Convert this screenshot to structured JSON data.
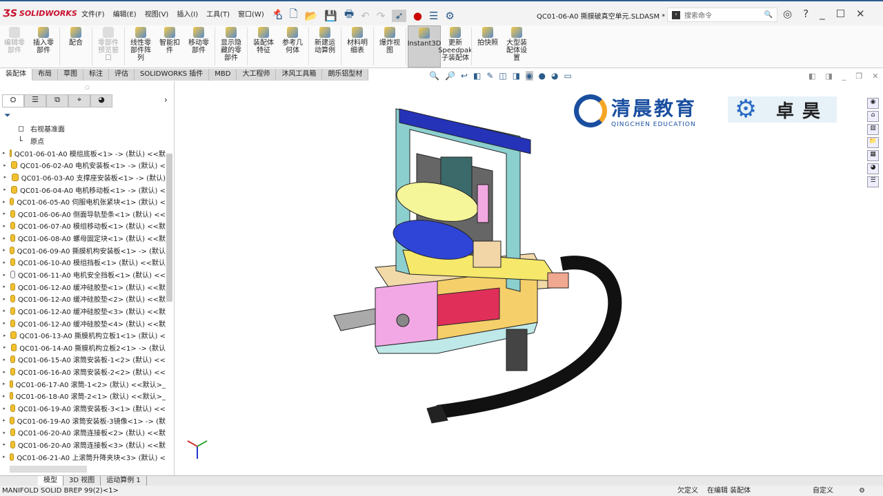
{
  "app": {
    "logo": "SOLIDWORKS",
    "title": "QC01-06-A0 撕膜破真空单元.SLDASM *",
    "search_placeholder": "搜索命令"
  },
  "menu": [
    "文件(F)",
    "编辑(E)",
    "视图(V)",
    "插入(I)",
    "工具(T)",
    "窗口(W)"
  ],
  "ribbon": [
    {
      "label": "编辑零部件",
      "disabled": true
    },
    {
      "label": "插入零部件"
    },
    {
      "label": "配合"
    },
    {
      "label": "零部件预览窗口",
      "disabled": true
    },
    {
      "label": "线性零部件阵列"
    },
    {
      "label": "智能扣件"
    },
    {
      "label": "移动零部件"
    },
    {
      "label": "显示隐藏的零部件"
    },
    {
      "label": "装配体特征"
    },
    {
      "label": "参考几何体"
    },
    {
      "label": "新建运动算例"
    },
    {
      "label": "材料明细表"
    },
    {
      "label": "爆炸视图"
    },
    {
      "label": "Instant3D",
      "selected": true
    },
    {
      "label": "更新Speedpak子装配体"
    },
    {
      "label": "拍快照"
    },
    {
      "label": "大型装配体设置"
    }
  ],
  "tabs": [
    "装配体",
    "布局",
    "草图",
    "标注",
    "评估",
    "SOLIDWORKS 插件",
    "MBD",
    "大工程师",
    "沐风工具箱",
    "朗乐铝型材"
  ],
  "tree": [
    {
      "label": "右视基准面",
      "type": "plane"
    },
    {
      "label": "原点",
      "type": "origin"
    },
    {
      "label": "QC01-06-01-A0 模组底板<1> -> (默认) <<默"
    },
    {
      "label": "QC01-06-02-A0 电机安装板<1> -> (默认) <"
    },
    {
      "label": "QC01-06-03-A0 支撑座安装板<1> -> (默认)"
    },
    {
      "label": "QC01-06-04-A0 电机移动板<1> -> (默认) <"
    },
    {
      "label": "QC01-06-05-A0 伺服电机张紧块<1> (默认) <"
    },
    {
      "label": "QC01-06-06-A0 侧面导轨垫条<1> (默认) <<"
    },
    {
      "label": "QC01-06-07-A0 模组移动板<1> (默认) <<默"
    },
    {
      "label": "QC01-06-08-A0 螺母固定块<1> (默认) <<默"
    },
    {
      "label": "QC01-06-09-A0 撕膜机构安装板<1> -> (默认"
    },
    {
      "label": "QC01-06-10-A0 模组挡板<1> (默认) <<默认"
    },
    {
      "label": "QC01-06-11-A0 电机安全挡板<1> (默认) <<",
      "light": true
    },
    {
      "label": "QC01-06-12-A0 缓冲硅胶垫<1> (默认) <<默"
    },
    {
      "label": "QC01-06-12-A0 缓冲硅胶垫<2> (默认) <<默"
    },
    {
      "label": "QC01-06-12-A0 缓冲硅胶垫<3> (默认) <<默"
    },
    {
      "label": "QC01-06-12-A0 缓冲硅胶垫<4> (默认) <<默"
    },
    {
      "label": "QC01-06-13-A0 撕膜机构立板1<1> (默认) <"
    },
    {
      "label": "QC01-06-14-A0 撕膜机构立板2<1> -> (默认"
    },
    {
      "label": "QC01-06-15-A0 滚筒安装板-1<2> (默认) <<"
    },
    {
      "label": "QC01-06-16-A0 滚筒安装板-2<2> (默认) <<"
    },
    {
      "label": "QC01-06-17-A0 滚筒-1<2> (默认) <<默认>_"
    },
    {
      "label": "QC01-06-18-A0 滚筒-2<1> (默认) <<默认>_"
    },
    {
      "label": "QC01-06-19-A0 滚筒安装板-3<1> (默认) <<"
    },
    {
      "label": "QC01-06-19-A0 滚筒安装板-3镜像<1> -> (默"
    },
    {
      "label": "QC01-06-20-A0 滚筒连接板<2> (默认) <<默"
    },
    {
      "label": "QC01-06-20-A0 滚筒连接板<3> (默认) <<默"
    },
    {
      "label": "QC01-06-21-A0 上滚筒升降夹块<3> (默认) <"
    }
  ],
  "bottom_tabs": [
    "模型",
    "3D 视图",
    "运动算例 1"
  ],
  "status": {
    "left": "MANIFOLD SOLID BREP 99(2)<1>",
    "state": "欠定义",
    "mode": "在编辑 装配体",
    "custom": "自定义"
  },
  "watermark": {
    "brand_cn": "清晨教育",
    "brand_en": "QINGCHEN EDUCATION",
    "brand2": "卓昊"
  }
}
